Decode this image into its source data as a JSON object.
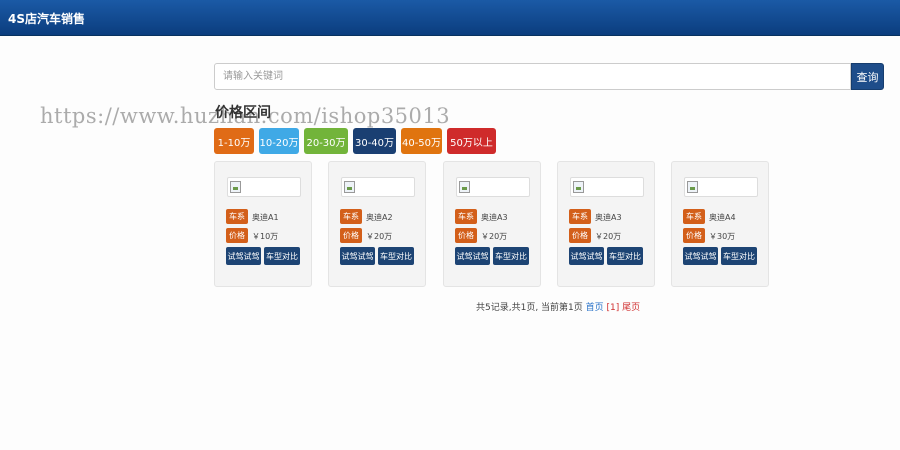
{
  "header": {
    "title": "4S店汽车销售"
  },
  "search": {
    "placeholder": "请输入关键词",
    "button_label": "查询"
  },
  "watermark": "https://www.huzhan.com/ishop35013",
  "price_section": {
    "title": "价格区间",
    "ranges": [
      {
        "label": "1-10万",
        "color": "#e06b16"
      },
      {
        "label": "10-20万",
        "color": "#3fa9e6"
      },
      {
        "label": "20-30万",
        "color": "#72b43a"
      },
      {
        "label": "30-40万",
        "color": "#1a3f72"
      },
      {
        "label": "40-50万",
        "color": "#e0740f"
      },
      {
        "label": "50万以上",
        "color": "#cf2b2b"
      }
    ]
  },
  "cars": [
    {
      "series_label": "车系",
      "series": "奥迪A1",
      "price_label": "价格",
      "price": "￥10万",
      "test_drive": "试驾试驾",
      "compare": "车型对比"
    },
    {
      "series_label": "车系",
      "series": "奥迪A2",
      "price_label": "价格",
      "price": "￥20万",
      "test_drive": "试驾试驾",
      "compare": "车型对比"
    },
    {
      "series_label": "车系",
      "series": "奥迪A3",
      "price_label": "价格",
      "price": "￥20万",
      "test_drive": "试驾试驾",
      "compare": "车型对比"
    },
    {
      "series_label": "车系",
      "series": "奥迪A3",
      "price_label": "价格",
      "price": "￥20万",
      "test_drive": "试驾试驾",
      "compare": "车型对比"
    },
    {
      "series_label": "车系",
      "series": "奥迪A4",
      "price_label": "价格",
      "price": "￥30万",
      "test_drive": "试驾试驾",
      "compare": "车型对比"
    }
  ],
  "pagination": {
    "summary": "共5记录,共1页, 当前第1页",
    "first": "首页",
    "current": "[1]",
    "last": "尾页"
  }
}
